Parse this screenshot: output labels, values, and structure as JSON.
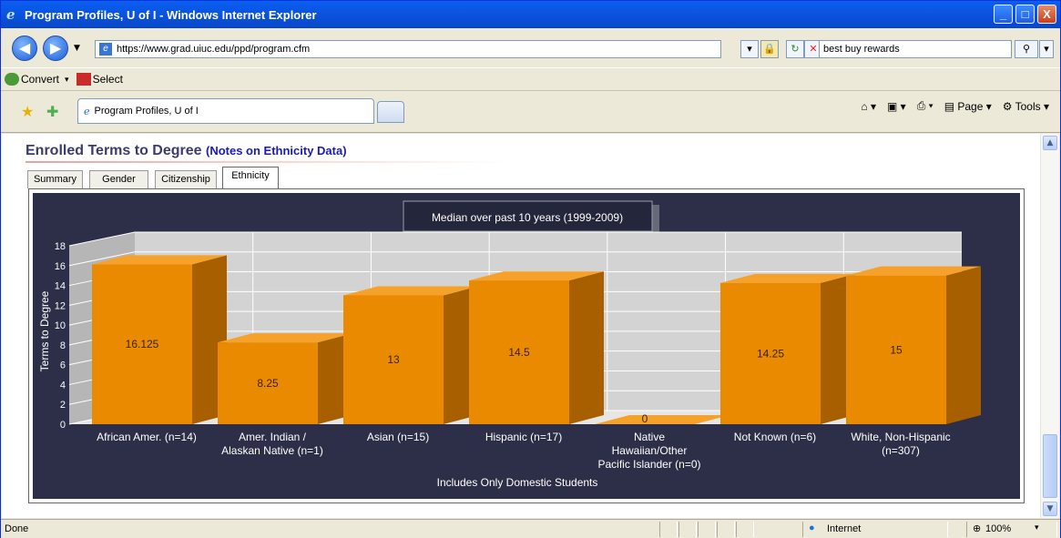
{
  "window": {
    "title": "Program Profiles, U of I - Windows Internet Explorer",
    "min_label": "_",
    "max_label": "□",
    "close_label": "X"
  },
  "nav": {
    "url": "https://www.grad.uiuc.edu/ppd/program.cfm",
    "search_value": "best buy rewards",
    "back_icon": "back-arrow-icon",
    "forward_icon": "forward-arrow-icon"
  },
  "links": {
    "convert_label": "Convert",
    "select_label": "Select"
  },
  "tabs": {
    "active_label": "Program Profiles, U of I"
  },
  "commands": {
    "page_label": "Page",
    "tools_label": "Tools"
  },
  "page": {
    "heading": "Enrolled Terms to Degree",
    "heading_link": "(Notes on Ethnicity Data)",
    "tabs": [
      "Summary",
      "Gender",
      "Citizenship",
      "Ethnicity"
    ],
    "active_tab": "Ethnicity"
  },
  "status": {
    "text": "Done",
    "zone": "Internet",
    "zoom": "100%"
  },
  "chart_data": {
    "type": "bar",
    "title": "Median over past 10 years (1999-2009)",
    "xlabel": "Includes Only Domestic Students",
    "ylabel": "Terms to Degree",
    "ylim": [
      0,
      18
    ],
    "yticks": [
      0,
      2,
      4,
      6,
      8,
      10,
      12,
      14,
      16,
      18
    ],
    "categories": [
      [
        "African Amer. (n=14)"
      ],
      [
        "Amer. Indian /",
        "Alaskan Native (n=1)"
      ],
      [
        "Asian (n=15)"
      ],
      [
        "Hispanic (n=17)"
      ],
      [
        "Native",
        "Hawaiian/Other",
        "Pacific Islander (n=0)"
      ],
      [
        "Not Known (n=6)"
      ],
      [
        "White, Non-Hispanic",
        "(n=307)"
      ]
    ],
    "values": [
      16.125,
      8.25,
      13,
      14.5,
      0,
      14.25,
      15
    ],
    "labels": [
      "16.125",
      "8.25",
      "13",
      "14.5",
      "0",
      "14.25",
      "15"
    ],
    "colors": {
      "front": "#e98a00",
      "side": "#a85f00",
      "top": "#f6a22a",
      "background": "#2d2f48",
      "wall": "#d3d3d3"
    }
  }
}
